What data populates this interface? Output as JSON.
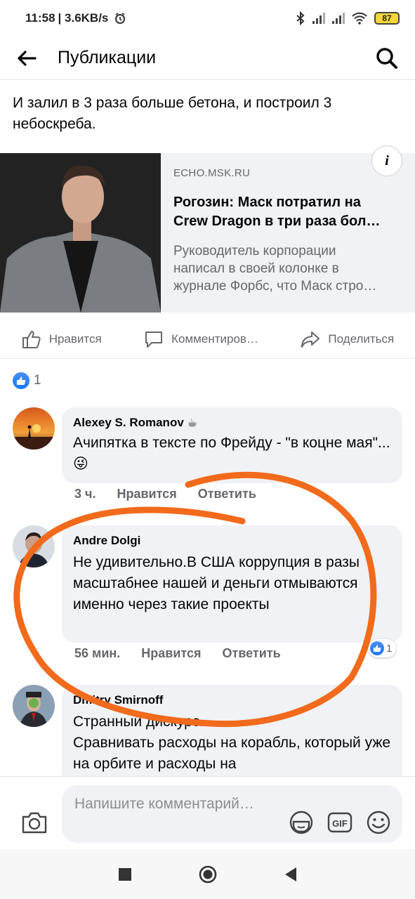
{
  "status_bar": {
    "time": "11:58",
    "speed": "| 3.6KB/s",
    "battery": "87"
  },
  "header": {
    "back_icon": "arrow-left-icon",
    "title": "Публикации",
    "search_icon": "search-icon"
  },
  "post": {
    "text": "И залил в 3 раза больше бетона, и построил 3 небоскреба."
  },
  "link_preview": {
    "domain": "ECHO.MSK.RU",
    "title_line1": "Рогозин: Маск потратил на",
    "title_line2": "Crew Dragon в три раза бол…",
    "desc_line1": "Руководитель корпорации",
    "desc_line2": "написал в своей колонке в",
    "desc_line3": "журнале Форбс, что Маск стро…",
    "info_label": "i"
  },
  "actions": {
    "like": "Нравится",
    "comment": "Комментиров…",
    "share": "Поделиться"
  },
  "reactions": {
    "count": "1"
  },
  "comments": [
    {
      "author": "Alexey S. Romanov",
      "emoji_badge": "☕",
      "text": "Ачипятка в тексте по Фрейду - \"в коцне мая\"...😜",
      "time": "3 ч.",
      "like": "Нравится",
      "reply": "Ответить"
    },
    {
      "author": "Andre Dolgi",
      "text": "Не удивительно.В США коррупция в разы масштабнее нашей и деньги отмываются именно через такие проекты",
      "time": "56 мин.",
      "like": "Нравится",
      "reply": "Ответить",
      "reaction_count": "1"
    },
    {
      "author": "Dmitry Smirnoff",
      "text_line1": "Странный дискурс.",
      "text_line2": "Сравнивать расходы на корабль, который уже на  орбите и расходы на"
    }
  ],
  "composer": {
    "placeholder": "Напишите комментарий…"
  },
  "colors": {
    "accent": "#1877f2",
    "annotation": "#f26a1b"
  }
}
